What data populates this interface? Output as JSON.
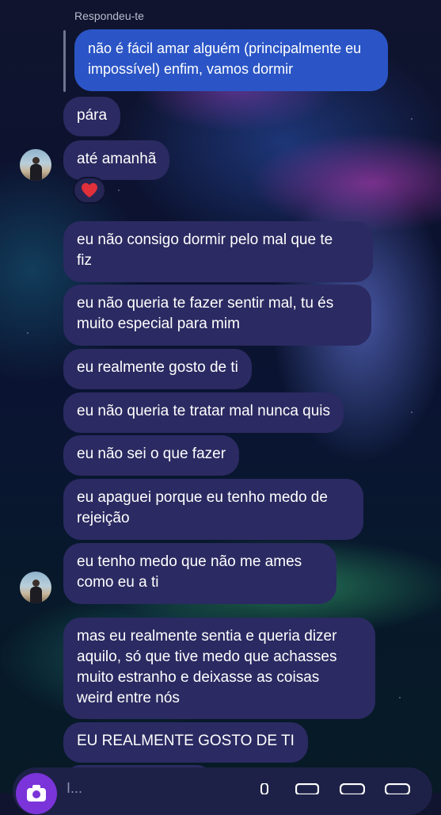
{
  "reply_header": "Respondeu-te",
  "replied_message": {
    "line1": "não é fácil amar alguém (principalmente eu",
    "line2": "impossível) enfim, vamos dormir"
  },
  "messages_a": [
    "pára",
    "até amanhã"
  ],
  "reaction": {
    "emoji": "❤️",
    "color": "#e0303a"
  },
  "messages_b": [
    {
      "line1": "eu não consigo dormir pelo mal que te",
      "line2": "fiz"
    },
    {
      "line1": "eu não queria te fazer sentir mal, tu és",
      "line2": "muito especial para mim"
    },
    {
      "line1": "eu realmente gosto de ti"
    },
    {
      "line1": "eu não queria te tratar mal nunca quis"
    },
    {
      "line1": "eu não sei o que fazer"
    },
    {
      "line1": "eu apaguei porque eu tenho medo de",
      "line2": "rejeição"
    },
    {
      "line1": "eu tenho medo que não me ames",
      "line2": "como eu a ti"
    }
  ],
  "messages_c": [
    {
      "line1": "mas eu realmente sentia e queria dizer",
      "line2": "aquilo, só que tive medo que achasses",
      "line3": "muito estranho e deixasse as coisas",
      "line4": "weird entre nós"
    },
    {
      "line1": "EU REALMENTE GOSTO DE TI"
    }
  ],
  "composer": {
    "placeholder": "I...",
    "icons": [
      "camera-icon",
      "microphone-icon",
      "gallery-icon",
      "sticker-icon",
      "plus-icon"
    ]
  },
  "colors": {
    "received_bubble": "#2b2a62",
    "sent_bubble": "#2b55c6",
    "camera_button": "#7a34d9"
  }
}
